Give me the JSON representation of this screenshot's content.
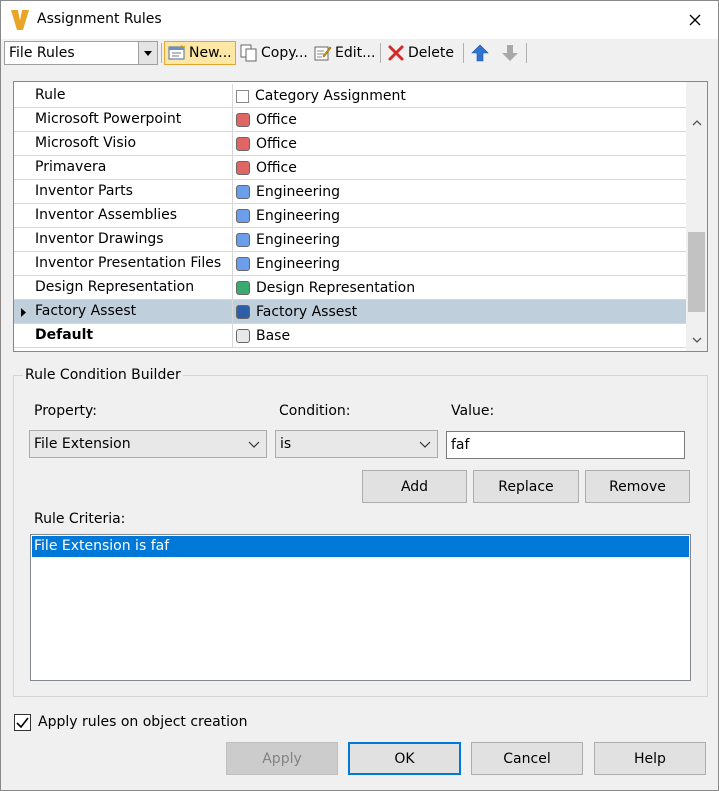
{
  "window": {
    "title": "Assignment Rules"
  },
  "toolbar": {
    "combo_value": "File Rules",
    "new_label": "New...",
    "copy_label": "Copy...",
    "edit_label": "Edit...",
    "delete_label": "Delete"
  },
  "grid": {
    "headers": {
      "rule": "Rule",
      "category": "Category Assignment"
    },
    "rows": [
      {
        "rule": "Microsoft Powerpoint",
        "category": "Office",
        "color": "#e06666",
        "bold": false,
        "selected": false
      },
      {
        "rule": "Microsoft Visio",
        "category": "Office",
        "color": "#e06666",
        "bold": false,
        "selected": false
      },
      {
        "rule": "Primavera",
        "category": "Office",
        "color": "#e06666",
        "bold": false,
        "selected": false
      },
      {
        "rule": "Inventor Parts",
        "category": "Engineering",
        "color": "#6d9eeb",
        "bold": false,
        "selected": false
      },
      {
        "rule": "Inventor Assemblies",
        "category": "Engineering",
        "color": "#6d9eeb",
        "bold": false,
        "selected": false
      },
      {
        "rule": "Inventor Drawings",
        "category": "Engineering",
        "color": "#6d9eeb",
        "bold": false,
        "selected": false
      },
      {
        "rule": "Inventor Presentation Files",
        "category": "Engineering",
        "color": "#6d9eeb",
        "bold": false,
        "selected": false
      },
      {
        "rule": "Design Representation",
        "category": "Design Representation",
        "color": "#3aaa6e",
        "bold": false,
        "selected": false
      },
      {
        "rule": "Factory Assest",
        "category": "Factory Assest",
        "color": "#2f5ea8",
        "bold": false,
        "selected": true
      },
      {
        "rule": "Default",
        "category": "Base",
        "color": "#e8e8e8",
        "bold": true,
        "selected": false
      }
    ]
  },
  "builder": {
    "group_title": "Rule Condition Builder",
    "property_label": "Property:",
    "condition_label": "Condition:",
    "value_label": "Value:",
    "property_value": "File Extension",
    "condition_value": "is",
    "value_text": "faf",
    "add_label": "Add",
    "replace_label": "Replace",
    "remove_label": "Remove",
    "criteria_label": "Rule Criteria:",
    "criteria_items": [
      "File Extension is faf"
    ]
  },
  "footer": {
    "apply_on_create_label": "Apply rules on object creation",
    "apply_on_create_checked": true,
    "apply_label": "Apply",
    "ok_label": "OK",
    "cancel_label": "Cancel",
    "help_label": "Help"
  }
}
